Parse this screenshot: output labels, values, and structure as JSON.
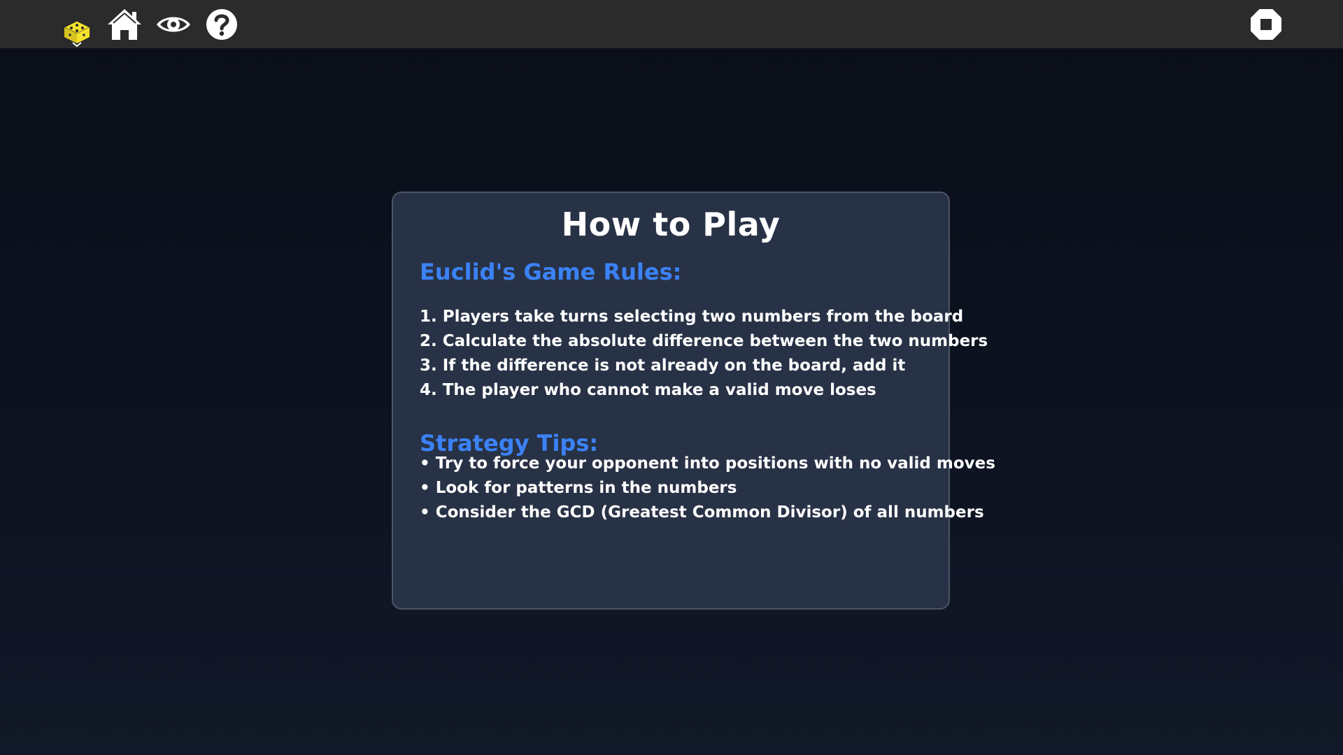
{
  "toolbar": {
    "activity_icon_color": "#f5e22b",
    "icon_color": "#ffffff",
    "background_color": "#2b2b2b"
  },
  "panel": {
    "title": "How to Play",
    "rules_heading": "Euclid's Game Rules:",
    "rules": [
      "1. Players take turns selecting two numbers from the board",
      "2. Calculate the absolute difference between the two numbers",
      "3. If the difference is not already on the board, add it",
      "4. The player who cannot make a valid move loses"
    ],
    "tips_heading": "Strategy Tips:",
    "tips": [
      "• Try to force your opponent into positions with no valid moves",
      "• Look for patterns in the numbers",
      "• Consider the GCD (Greatest Common Divisor) of all numbers"
    ],
    "heading_color": "#3b82f6",
    "background_color": "#283246"
  }
}
